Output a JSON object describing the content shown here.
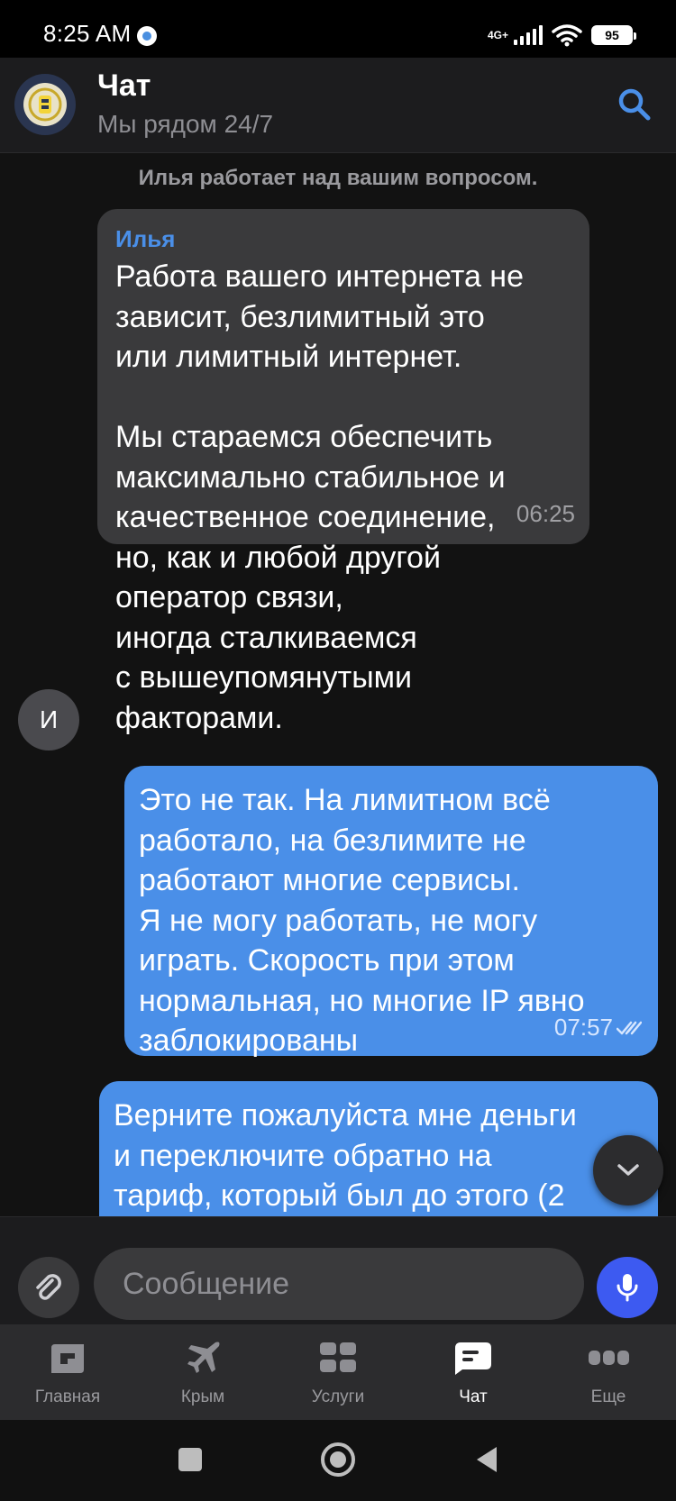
{
  "status_bar": {
    "time": "8:25 AM",
    "network": "4G+",
    "battery": "95"
  },
  "header": {
    "title": "Чат",
    "subtitle": "Мы рядом 24/7"
  },
  "chat": {
    "system_message": "Илья работает над вашим вопросом.",
    "incoming": {
      "sender": "Илья",
      "text": "Работа вашего интернета не\nзависит, безлимитный это\nили лимитный интернет.\n\nМы стараемся обеспечить\nмаксимально стабильное и\nкачественное соединение,\nно, как и любой другой\nоператор связи,\nиногда сталкиваемся\nс вышеупомянутыми\nфакторами.",
      "time": "06:25",
      "avatar_letter": "И"
    },
    "outgoing": [
      {
        "text": "Это не так. На лимитном всё\nработало, на безлимите не\nработают многие сервисы.\nЯ не могу работать, не могу\nиграть. Скорость при этом\nнормальная, но многие IP явно\nзаблокированы",
        "time": "07:57"
      },
      {
        "text": "Верните пожалуйста мне деньги\nи переключите обратно на\nтариф, который был до этого (2"
      }
    ]
  },
  "input": {
    "placeholder": "Сообщение"
  },
  "nav": [
    {
      "label": "Главная",
      "icon": "home-icon"
    },
    {
      "label": "Крым",
      "icon": "plane-icon"
    },
    {
      "label": "Услуги",
      "icon": "grid-icon"
    },
    {
      "label": "Чат",
      "icon": "chat-icon",
      "active": true
    },
    {
      "label": "Еще",
      "icon": "more-icon"
    }
  ],
  "colors": {
    "accent": "#4a8fe8",
    "mic": "#3d5af1",
    "background": "#121212"
  }
}
